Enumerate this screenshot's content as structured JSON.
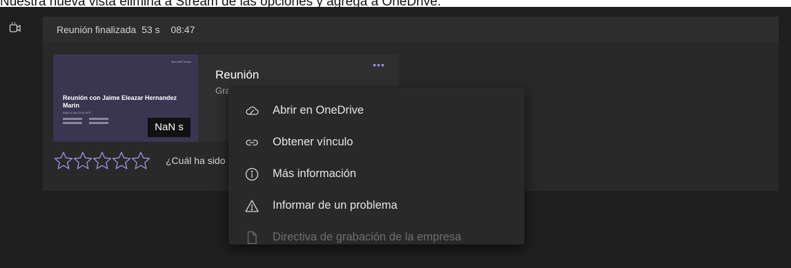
{
  "caption": "Nuestra nueva vista elimina a Stream de las opciones y agrega a OneDrive.",
  "header": {
    "status": "Reunión finalizada",
    "duration": "53 s",
    "time": "08:47"
  },
  "card": {
    "title": "Reunión",
    "subtitle": "Gra",
    "thumbnail": {
      "brand": "Microsoft Teams",
      "title": "Reunión con Jaime Eleazar Hernandez Marin",
      "date": "2021-07-08 12:44 UTC",
      "badge": "NaN s"
    }
  },
  "rating": {
    "stars": 5,
    "prompt": "¿Cuál ha sido"
  },
  "menu": {
    "items": [
      {
        "label": "Abrir en OneDrive",
        "icon": "cloud-icon",
        "disabled": false
      },
      {
        "label": "Obtener vínculo",
        "icon": "link-icon",
        "disabled": false
      },
      {
        "label": "Más información",
        "icon": "info-icon",
        "disabled": false
      },
      {
        "label": "Informar de un problema",
        "icon": "warning-icon",
        "disabled": false
      },
      {
        "label": "Directiva de grabación de la empresa",
        "icon": "document-icon",
        "disabled": true
      }
    ]
  },
  "colors": {
    "background": "#1f1f1f",
    "panel": "#292929",
    "accent": "#9b8fe6",
    "thumbnail": "#3a3550"
  }
}
